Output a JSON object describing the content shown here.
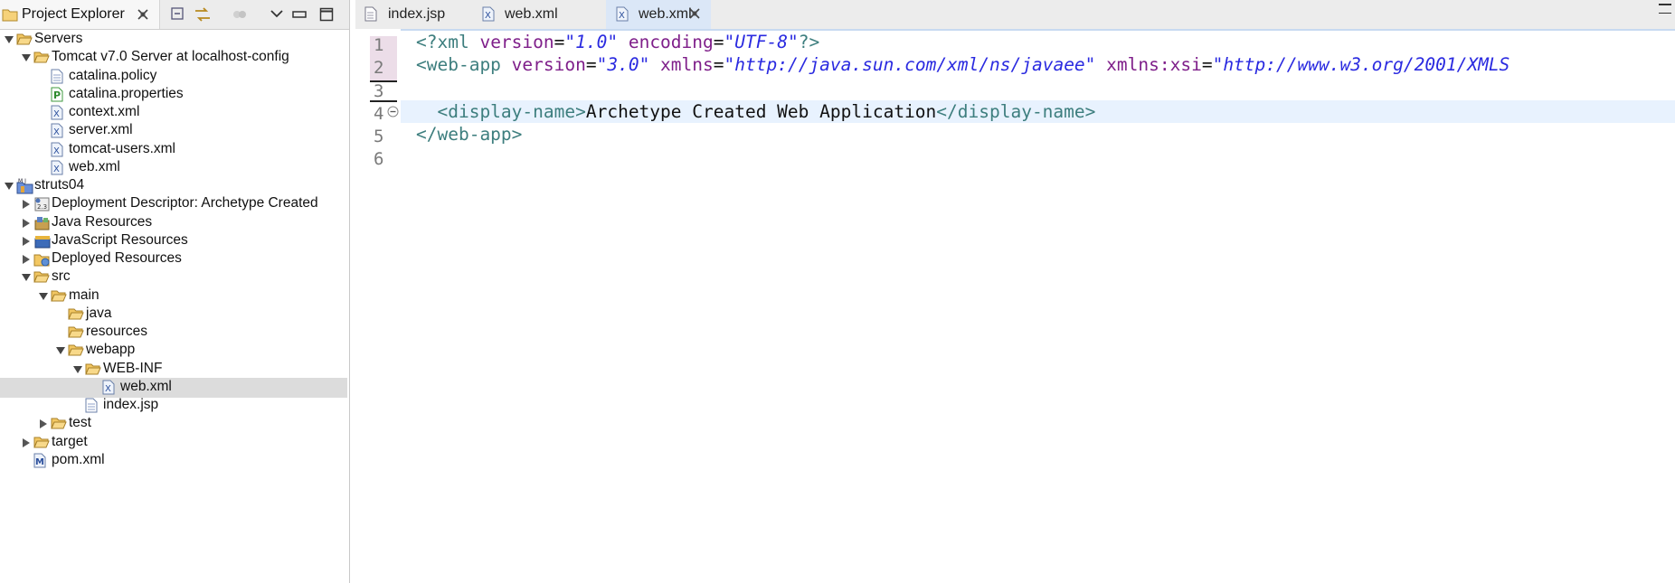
{
  "left_panel": {
    "tab_title": "Project Explorer",
    "tree": [
      {
        "label": "Servers",
        "indent": 0,
        "expanded": true,
        "icon": "folder-open-icon",
        "selected": false
      },
      {
        "label": "Tomcat v7.0 Server at localhost-config",
        "indent": 1,
        "expanded": true,
        "icon": "folder-open-icon",
        "selected": false
      },
      {
        "label": "catalina.policy",
        "indent": 2,
        "expanded": null,
        "icon": "text-file-icon",
        "selected": false
      },
      {
        "label": "catalina.properties",
        "indent": 2,
        "expanded": null,
        "icon": "properties-file-icon",
        "selected": false
      },
      {
        "label": "context.xml",
        "indent": 2,
        "expanded": null,
        "icon": "xml-file-icon",
        "selected": false
      },
      {
        "label": "server.xml",
        "indent": 2,
        "expanded": null,
        "icon": "xml-file-icon",
        "selected": false
      },
      {
        "label": "tomcat-users.xml",
        "indent": 2,
        "expanded": null,
        "icon": "xml-file-icon",
        "selected": false
      },
      {
        "label": "web.xml",
        "indent": 2,
        "expanded": null,
        "icon": "xml-file-icon",
        "selected": false
      },
      {
        "label": "struts04",
        "indent": 0,
        "expanded": true,
        "icon": "maven-project-icon",
        "selected": false
      },
      {
        "label": "Deployment Descriptor: Archetype Created",
        "indent": 1,
        "expanded": false,
        "icon": "deployment-descriptor-icon",
        "selected": false
      },
      {
        "label": "Java Resources",
        "indent": 1,
        "expanded": false,
        "icon": "java-resources-icon",
        "selected": false
      },
      {
        "label": "JavaScript Resources",
        "indent": 1,
        "expanded": false,
        "icon": "javascript-resources-icon",
        "selected": false
      },
      {
        "label": "Deployed Resources",
        "indent": 1,
        "expanded": false,
        "icon": "deployed-resources-icon",
        "selected": false
      },
      {
        "label": "src",
        "indent": 1,
        "expanded": true,
        "icon": "folder-open-icon",
        "selected": false
      },
      {
        "label": "main",
        "indent": 2,
        "expanded": true,
        "icon": "folder-open-icon",
        "selected": false
      },
      {
        "label": "java",
        "indent": 3,
        "expanded": null,
        "icon": "folder-open-icon",
        "selected": false
      },
      {
        "label": "resources",
        "indent": 3,
        "expanded": null,
        "icon": "folder-open-icon",
        "selected": false
      },
      {
        "label": "webapp",
        "indent": 3,
        "expanded": true,
        "icon": "folder-open-icon",
        "selected": false
      },
      {
        "label": "WEB-INF",
        "indent": 4,
        "expanded": true,
        "icon": "folder-open-icon",
        "selected": false
      },
      {
        "label": "web.xml",
        "indent": 5,
        "expanded": null,
        "icon": "xml-file-icon",
        "selected": true
      },
      {
        "label": "index.jsp",
        "indent": 4,
        "expanded": null,
        "icon": "text-file-icon",
        "selected": false
      },
      {
        "label": "test",
        "indent": 2,
        "expanded": false,
        "icon": "folder-open-icon",
        "selected": false
      },
      {
        "label": "target",
        "indent": 1,
        "expanded": false,
        "icon": "folder-open-icon",
        "selected": false
      },
      {
        "label": "pom.xml",
        "indent": 1,
        "expanded": null,
        "icon": "maven-pom-icon",
        "selected": false
      }
    ]
  },
  "editor": {
    "tabs": [
      {
        "label": "index.jsp",
        "icon": "text-file-icon",
        "active": false
      },
      {
        "label": "web.xml",
        "icon": "xml-file-icon",
        "active": false
      },
      {
        "label": "web.xml",
        "icon": "xml-file-icon",
        "active": true
      }
    ],
    "line_numbers": [
      "1",
      "2",
      "3",
      "4",
      "5",
      "6"
    ],
    "code": {
      "l1_open": "<?xml ",
      "l1_attr1": "version",
      "l1_eq1": "=",
      "l1_val1": "\"1.0\"",
      "l1_attr2": " encoding",
      "l1_eq2": "=",
      "l1_val2": "\"UTF-8\"",
      "l1_close": "?>",
      "l2_open": "<web-app ",
      "l2_attr1": "version",
      "l2_eq1": "=",
      "l2_val1": "\"3.0\"",
      "l2_attr2": " xmlns",
      "l2_eq2": "=",
      "l2_val2": "\"http://java.sun.com/xml/ns/javaee\"",
      "l2_attr3": " xmlns:xsi",
      "l2_eq3": "=",
      "l2_val3": "\"http://www.w3.org/2001/XMLS",
      "l4_indent": "  ",
      "l4_open": "<display-name>",
      "l4_text": "Archetype Created Web Application",
      "l4_close": "</display-name>",
      "l5_close": "</web-app>"
    }
  },
  "colors": {
    "tag": "#3d7e7e",
    "attribute": "#7f1f8a",
    "value": "#2a2ae0",
    "current_line": "#e8f2fe",
    "selection": "#dcdcdc"
  }
}
